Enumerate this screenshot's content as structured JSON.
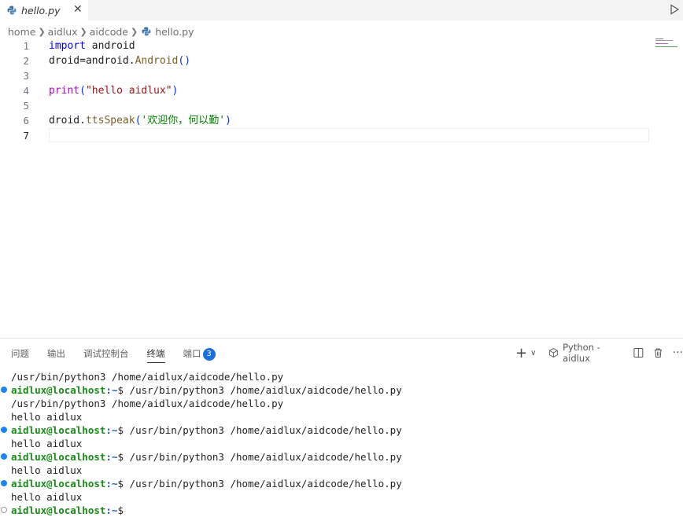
{
  "tab": {
    "filename": "hello.py",
    "close": "✕"
  },
  "breadcrumb": {
    "parts": [
      "home",
      "aidlux",
      "aidcode"
    ],
    "file": "hello.py"
  },
  "editor": {
    "line_numbers": [
      "1",
      "2",
      "3",
      "4",
      "5",
      "6",
      "7"
    ],
    "line1": {
      "kw": "import",
      "rest": " android"
    },
    "line2": {
      "pre": "droid=android.",
      "fn": "Android",
      "paren": "()"
    },
    "line4": {
      "fn": "print",
      "open": "(",
      "str": "\"hello aidlux\"",
      "close": ")"
    },
    "line6": {
      "pre": "droid.",
      "fn": "ttsSpeak",
      "open": "(",
      "str": "'欢迎你，何以勤'",
      "close": ")"
    }
  },
  "panel": {
    "tabs": [
      "问题",
      "输出",
      "调试控制台",
      "终端",
      "端口"
    ],
    "ports_badge": "3",
    "plus": "+",
    "chevron": "∨",
    "terminal_name": "Python - aidlux",
    "more": "···"
  },
  "terminal": {
    "cmd": "/usr/bin/python3 /home/aidlux/aidcode/hello.py",
    "user": "aidlux@localhost",
    "path": ":~",
    "dollar": "$ ",
    "output": "hello aidlux"
  }
}
